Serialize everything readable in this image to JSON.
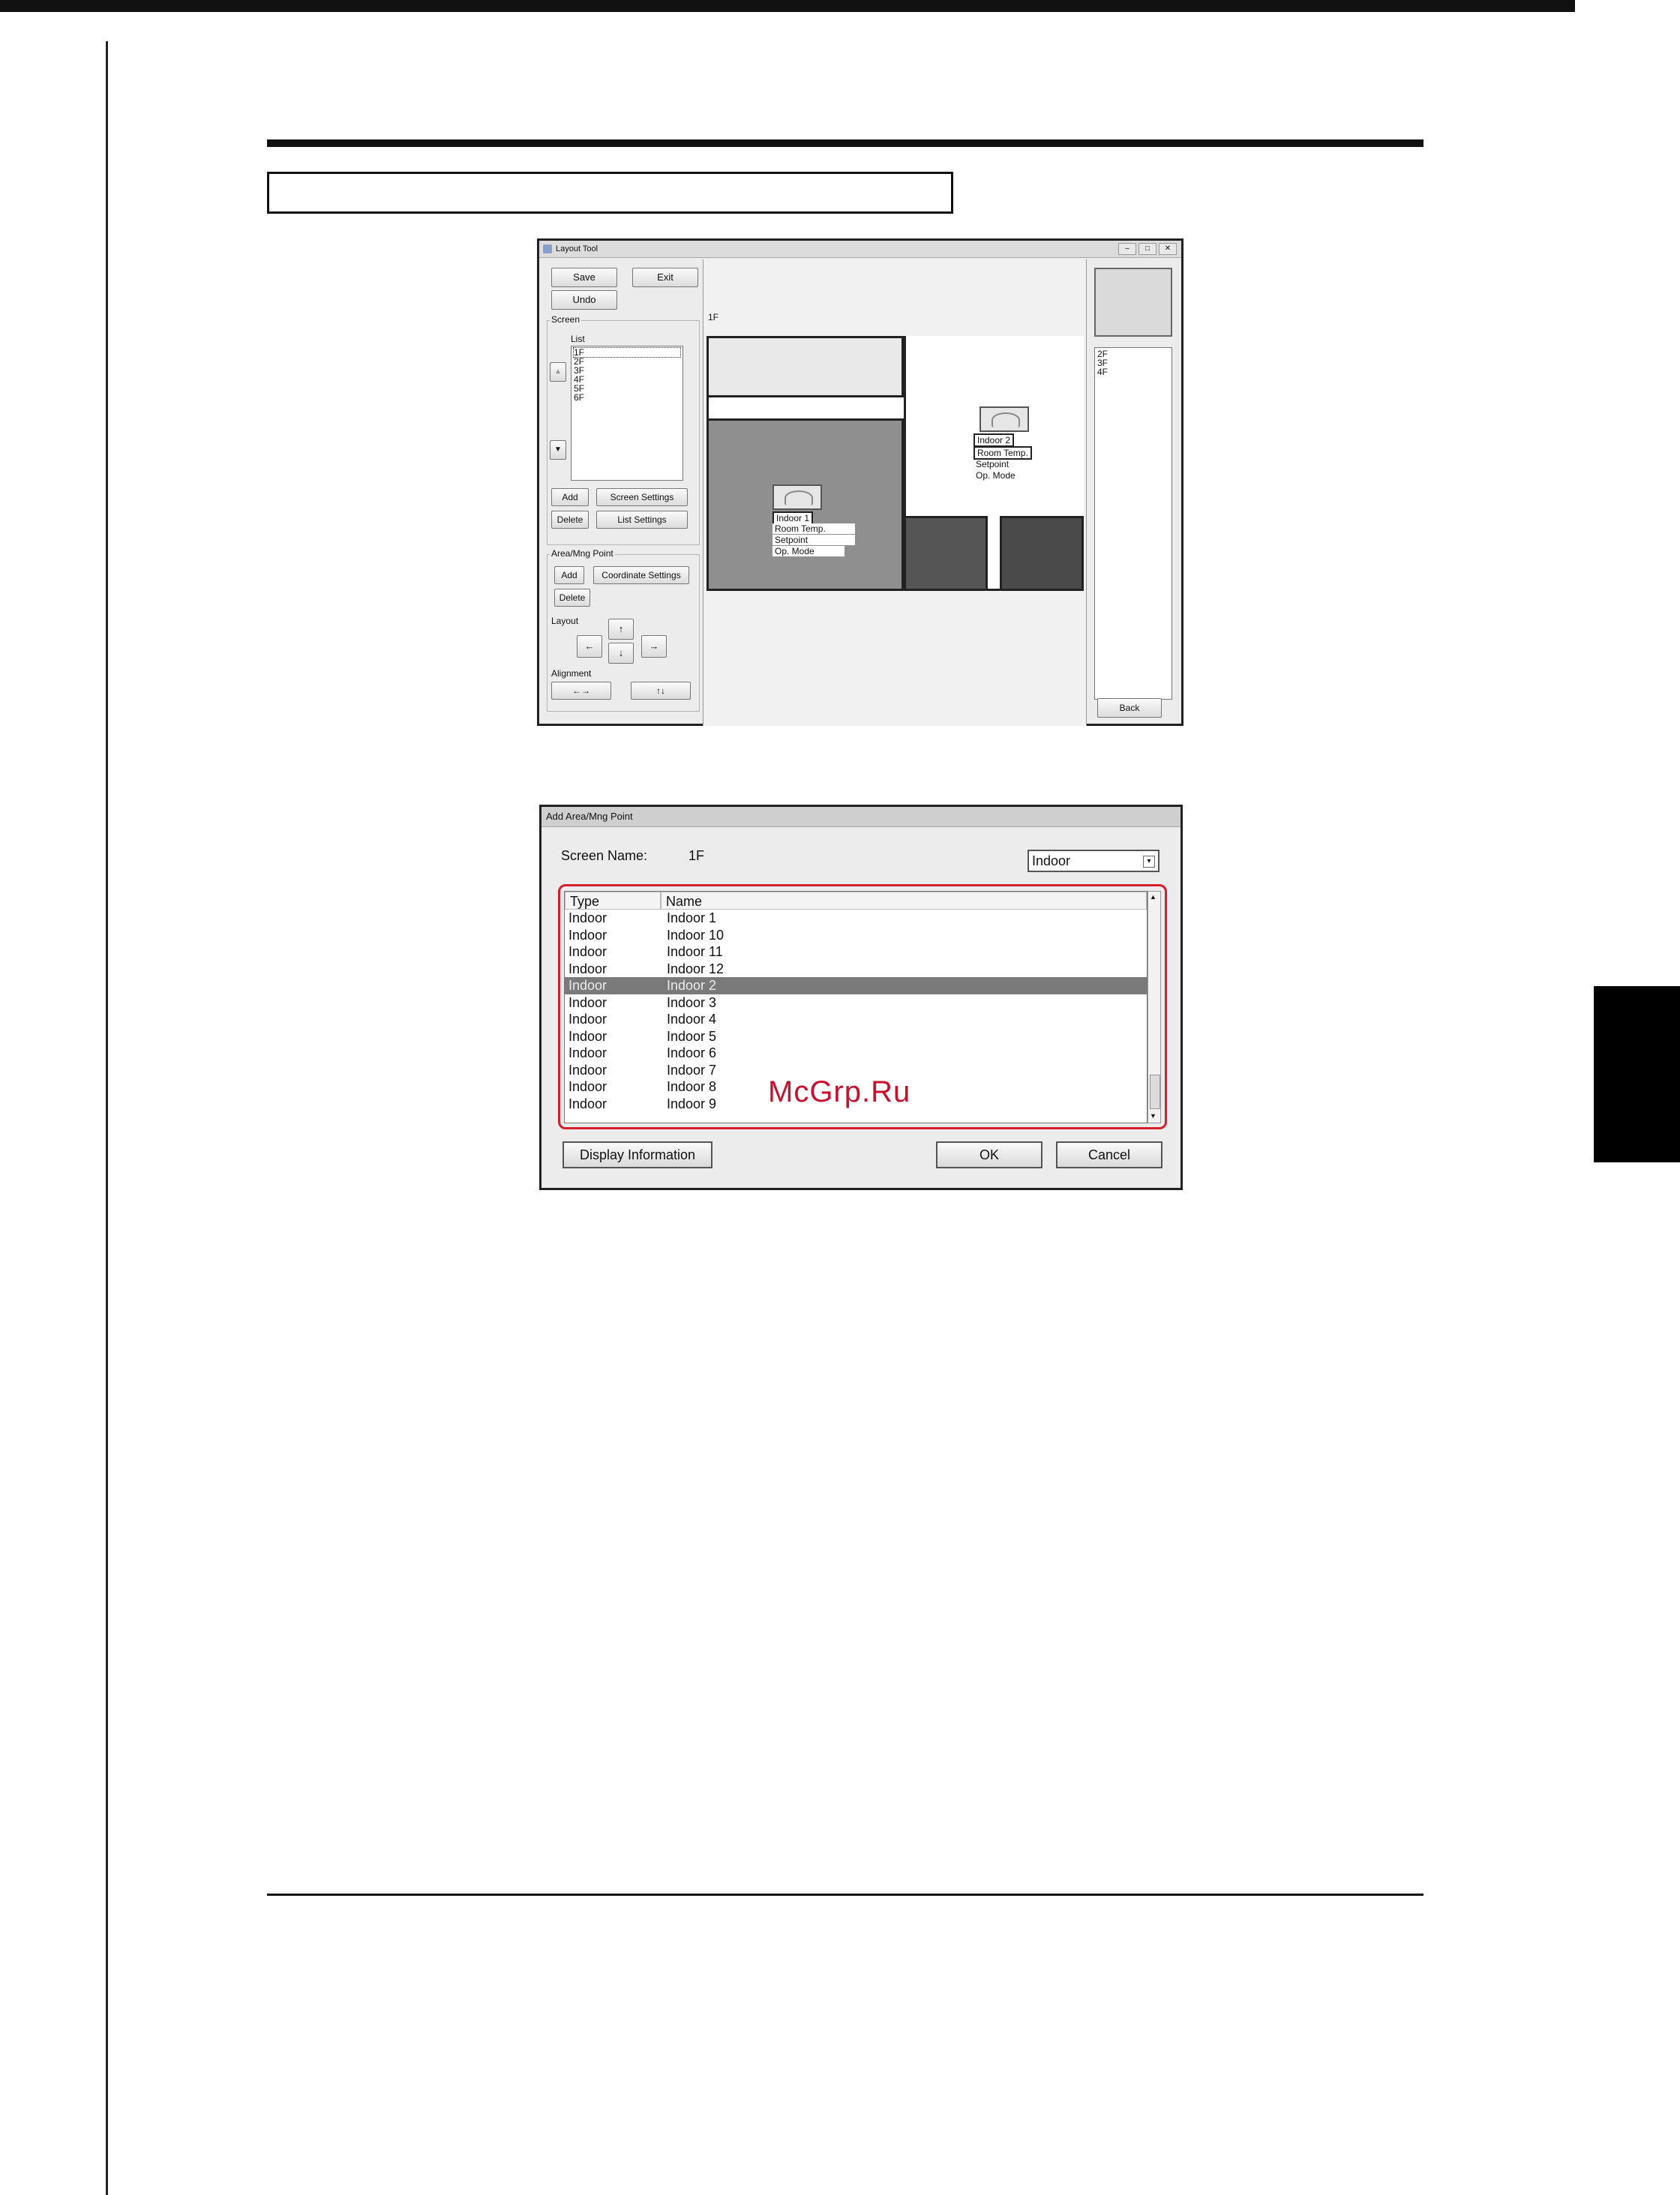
{
  "layout_tool": {
    "window_title": "Layout Tool",
    "buttons": {
      "save": "Save",
      "exit": "Exit",
      "undo": "Undo"
    },
    "screen_group": {
      "title": "Screen",
      "list_label": "List",
      "items": [
        "1F",
        "2F",
        "3F",
        "4F",
        "5F",
        "6F"
      ],
      "scroll_up": "▲",
      "scroll_down": "▼",
      "add": "Add",
      "screen_settings": "Screen Settings",
      "delete": "Delete",
      "list_settings": "List Settings"
    },
    "area_group": {
      "title": "Area/Mng Point",
      "add": "Add",
      "coordinate_settings": "Coordinate Settings",
      "delete": "Delete",
      "layout_label": "Layout",
      "arrow_up": "↑",
      "arrow_left": "←",
      "arrow_down": "↓",
      "arrow_right": "→",
      "alignment_label": "Alignment",
      "align_horizontal": "←→",
      "align_vertical": "↑↓"
    },
    "canvas": {
      "screen_label": "1F",
      "device1": {
        "name": "Indoor 1",
        "room_temp": "Room Temp.",
        "setpoint": "Setpoint",
        "op_mode": "Op. Mode"
      },
      "device2": {
        "name": "Indoor 2",
        "room_temp": "Room Temp.",
        "setpoint": "Setpoint",
        "op_mode": "Op. Mode"
      }
    },
    "right_panel": {
      "items": [
        "2F",
        "3F",
        "4F"
      ],
      "back": "Back"
    }
  },
  "add_dialog": {
    "title": "Add Area/Mng Point",
    "screen_name_label": "Screen Name:",
    "screen_name_value": "1F",
    "type_filter": "Indoor",
    "table": {
      "headers": [
        "Type",
        "Name"
      ],
      "rows": [
        [
          "Indoor",
          "Indoor 1"
        ],
        [
          "Indoor",
          "Indoor 10"
        ],
        [
          "Indoor",
          "Indoor 11"
        ],
        [
          "Indoor",
          "Indoor 12"
        ],
        [
          "Indoor",
          "Indoor 2"
        ],
        [
          "Indoor",
          "Indoor 3"
        ],
        [
          "Indoor",
          "Indoor 4"
        ],
        [
          "Indoor",
          "Indoor 5"
        ],
        [
          "Indoor",
          "Indoor 6"
        ],
        [
          "Indoor",
          "Indoor 7"
        ],
        [
          "Indoor",
          "Indoor 8"
        ],
        [
          "Indoor",
          "Indoor 9"
        ]
      ],
      "selected_row_name": "Indoor 2"
    },
    "buttons": {
      "display_information": "Display Information",
      "ok": "OK",
      "cancel": "Cancel"
    }
  },
  "watermark": "McGrp.Ru",
  "colors": {
    "highlight_frame": "#d4202c",
    "selected_row": "#7a7a7a",
    "side_tab": "#000000"
  }
}
